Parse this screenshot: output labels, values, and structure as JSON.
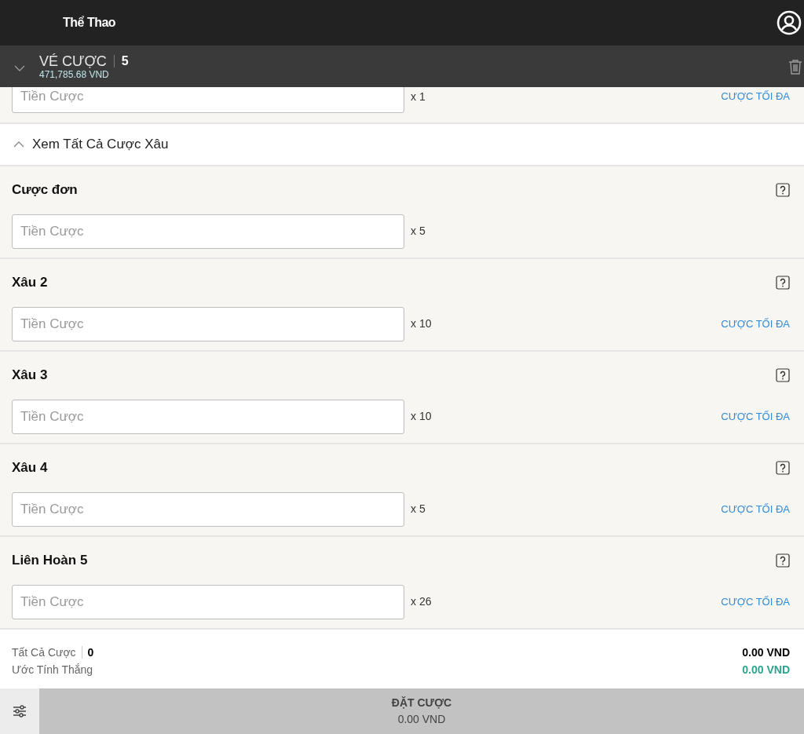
{
  "header": {
    "title": "Thể Thao"
  },
  "betslip": {
    "title": "VÉ CƯỢC",
    "count": "5",
    "balance": "471,785.68 VND",
    "expanded": true
  },
  "partial_row": {
    "placeholder": "Tiền Cược",
    "multiplier": "x 1",
    "max_bet": "CƯỢC TỐI ĐA"
  },
  "toggle": {
    "label": "Xem Tất Cả Cược Xâu",
    "expanded": true
  },
  "bets": [
    {
      "title": "Cược đơn",
      "placeholder": "Tiền Cược",
      "multiplier": "x 5"
    },
    {
      "title": "Xâu 2",
      "placeholder": "Tiền Cược",
      "multiplier": "x 10",
      "max_bet": "CƯỢC TỐI ĐA"
    },
    {
      "title": "Xâu 3",
      "placeholder": "Tiền Cược",
      "multiplier": "x 10",
      "max_bet": "CƯỢC TỐI ĐA"
    },
    {
      "title": "Xâu 4",
      "placeholder": "Tiền Cược",
      "multiplier": "x 5",
      "max_bet": "CƯỢC TỐI ĐA"
    },
    {
      "title": "Liên Hoàn 5",
      "placeholder": "Tiền Cược",
      "multiplier": "x 26",
      "max_bet": "CƯỢC TỐI ĐA"
    }
  ],
  "summary": {
    "total_label": "Tất Cả Cược",
    "total_count": "0",
    "total_amount": "0.00 VND",
    "win_label": "Ước Tính Thắng",
    "win_amount": "0.00 VND"
  },
  "place_bet": {
    "label": "ĐẶT CƯỢC",
    "amount": "0.00 VND",
    "disabled": true
  }
}
